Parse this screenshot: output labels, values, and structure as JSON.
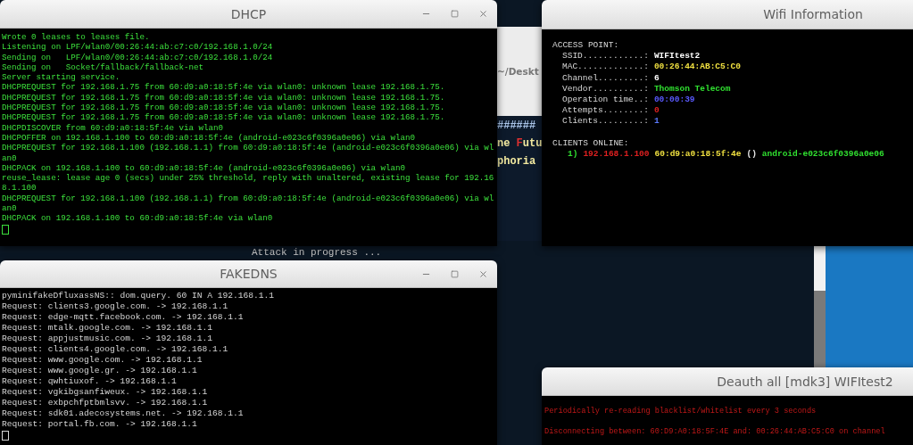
{
  "background_terminal": {
    "title": "~/Deskt",
    "lines": [
      {
        "parts": [
          {
            "text": "######",
            "color": "#a9c4e8"
          }
        ]
      },
      {
        "parts": [
          {
            "text": "ne ",
            "color": "#f2e9a0"
          },
          {
            "text": "F",
            "color": "#e03030"
          },
          {
            "text": "utu",
            "color": "#f2e9a0"
          }
        ]
      },
      {
        "parts": [
          {
            "text": "phoria",
            "color": "#f2e9a0"
          }
        ]
      }
    ],
    "status": "Attack in progress ..."
  },
  "dhcp_window": {
    "title": "DHCP",
    "lines": [
      "Wrote 0 leases to leases file.",
      "Listening on LPF/wlan0/00:26:44:ab:c7:c0/192.168.1.0/24",
      "Sending on   LPF/wlan0/00:26:44:ab:c7:c0/192.168.1.0/24",
      "Sending on   Socket/fallback/fallback-net",
      "Server starting service.",
      "DHCPREQUEST for 192.168.1.75 from 60:d9:a0:18:5f:4e via wlan0: unknown lease 192.168.1.75.",
      "DHCPREQUEST for 192.168.1.75 from 60:d9:a0:18:5f:4e via wlan0: unknown lease 192.168.1.75.",
      "DHCPREQUEST for 192.168.1.75 from 60:d9:a0:18:5f:4e via wlan0: unknown lease 192.168.1.75.",
      "DHCPREQUEST for 192.168.1.75 from 60:d9:a0:18:5f:4e via wlan0: unknown lease 192.168.1.75.",
      "DHCPDISCOVER from 60:d9:a0:18:5f:4e via wlan0",
      "DHCPOFFER on 192.168.1.100 to 60:d9:a0:18:5f:4e (android-e023c6f0396a0e06) via wlan0",
      "DHCPREQUEST for 192.168.1.100 (192.168.1.1) from 60:d9:a0:18:5f:4e (android-e023c6f0396a0e06) via wl",
      "an0",
      "DHCPACK on 192.168.1.100 to 60:d9:a0:18:5f:4e (android-e023c6f0396a0e06) via wlan0",
      "reuse_lease: lease age 0 (secs) under 25% threshold, reply with unaltered, existing lease for 192.16",
      "8.1.100",
      "DHCPREQUEST for 192.168.1.100 (192.168.1.1) from 60:d9:a0:18:5f:4e (android-e023c6f0396a0e06) via wl",
      "an0",
      "DHCPACK on 192.168.1.100 to 60:d9:a0:18:5f:4e via wlan0"
    ]
  },
  "fakedns_window": {
    "title": "FAKEDNS",
    "lines": [
      "pyminifakeDfluxassNS:: dom.query. 60 IN A 192.168.1.1",
      "Request: clients3.google.com. -> 192.168.1.1",
      "Request: edge-mqtt.facebook.com. -> 192.168.1.1",
      "Request: mtalk.google.com. -> 192.168.1.1",
      "Request: appjustmusic.com. -> 192.168.1.1",
      "Request: clients4.google.com. -> 192.168.1.1",
      "Request: www.google.com. -> 192.168.1.1",
      "Request: www.google.gr. -> 192.168.1.1",
      "Request: qwhtiuxof. -> 192.168.1.1",
      "Request: vgkibgsanfiweux. -> 192.168.1.1",
      "Request: exbpchfptbmlsvv. -> 192.168.1.1",
      "Request: sdk01.adecosystems.net. -> 192.168.1.1",
      "Request: portal.fb.com. -> 192.168.1.1"
    ]
  },
  "wifi_window": {
    "title": "Wifi Information",
    "access_point_heading": "ACCESS POINT:",
    "fields": [
      {
        "label": "SSID............:",
        "value": "WIFItest2",
        "color": "#ffffff"
      },
      {
        "label": "MAC.............:",
        "value": "00:26:44:AB:C5:C0",
        "color": "#f0e040"
      },
      {
        "label": "Channel.........:",
        "value": "6",
        "color": "#ffffff"
      },
      {
        "label": "Vendor..........:",
        "value": "Thomson Telecom",
        "color": "#30e030"
      },
      {
        "label": "Operation time..:",
        "value": "00:00:39",
        "color": "#5a5aff"
      },
      {
        "label": "Attempts........:",
        "value": "0",
        "color": "#e02020"
      },
      {
        "label": "Clients.........:",
        "value": "1",
        "color": "#5a7aff"
      }
    ],
    "clients_heading": "CLIENTS ONLINE:",
    "clients": [
      {
        "number": "1)",
        "ip": "192.168.1.100",
        "mac": "60:d9:a0:18:5f:4e",
        "info": "()",
        "hostname": "android-e023c6f0396a0e06"
      }
    ]
  },
  "deauth_window": {
    "title": "Deauth all [mdk3]  WIFItest2",
    "lines": [
      {
        "kind": "notice",
        "text": "Periodically re-reading blacklist/whitelist every 3 seconds"
      },
      {
        "kind": "disconnect",
        "text": "Disconnecting between: 60:D9:A0:18:5F:4E and: 00:26:44:AB:C5:C0 on channel"
      }
    ]
  }
}
